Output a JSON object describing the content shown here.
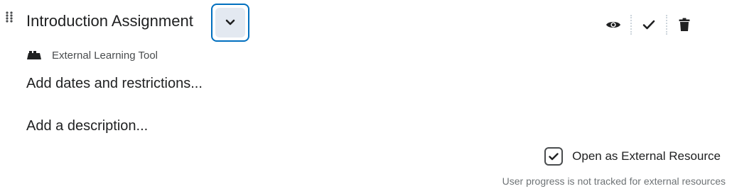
{
  "item": {
    "title": "Introduction Assignment",
    "tool_type": "External Learning Tool",
    "add_dates_label": "Add dates and restrictions...",
    "add_description_label": "Add a description..."
  },
  "actions": {
    "visibility_icon": "eye-icon",
    "complete_icon": "checkmark-icon",
    "delete_icon": "trash-icon"
  },
  "external_resource": {
    "checked": true,
    "label": "Open as External Resource",
    "note": "User progress is not tracked for external resources"
  },
  "colors": {
    "accent": "#006fbf",
    "button_bg": "#e3e9f1",
    "text": "#202122",
    "muted": "#6e7376"
  }
}
